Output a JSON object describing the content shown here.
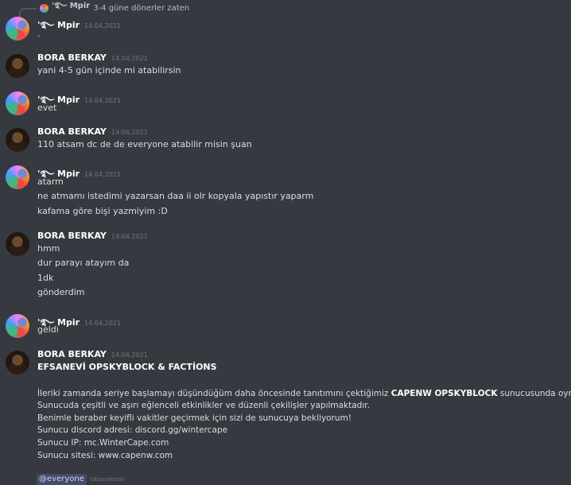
{
  "reply": {
    "author": "'࿐ Mpir",
    "text": "3-4 güne dönerler zaten"
  },
  "messages": [
    {
      "author": "'࿐ Mpir",
      "timestamp": "14.04.2021",
      "avatar": "mpir",
      "lines": [
        "."
      ]
    },
    {
      "author": "BORA BERKAY",
      "timestamp": "14.04.2021",
      "avatar": "bora",
      "lines": [
        "yani 4-5 gün içinde mi atabilirsin"
      ]
    },
    {
      "author": "'࿐ Mpir",
      "timestamp": "14.04.2021",
      "avatar": "mpir",
      "lines": [
        "evet"
      ]
    },
    {
      "author": "BORA BERKAY",
      "timestamp": "14.04.2021",
      "avatar": "bora",
      "lines": [
        "110 atsam dc de de everyone atabilir misin şuan"
      ]
    },
    {
      "author": "'࿐ Mpir",
      "timestamp": "14.04.2021",
      "avatar": "mpir",
      "lines": [
        "atarm",
        "ne atmamı istedimi yazarsan daa ii olr kopyala yapıstır yaparm",
        "kafama göre bişi yazmiyim :D"
      ]
    },
    {
      "author": "BORA BERKAY",
      "timestamp": "14.04.2021",
      "avatar": "bora",
      "lines": [
        "hmm",
        "dur parayı atayım da",
        "1dk",
        "gönderdim"
      ]
    },
    {
      "author": "'࿐ Mpir",
      "timestamp": "14.04.2021",
      "avatar": "mpir",
      "lines": [
        "geldi"
      ]
    },
    {
      "author": "BORA BERKAY",
      "timestamp": "14.04.2021",
      "avatar": "bora",
      "title": "EFSANEVİ OPSKYBLOCK & FACTİONS",
      "body": {
        "line1_prefix": "İleriki zamanda seriye başlamayı düşündüğüm daha öncesinde tanıtımını çektiğimiz",
        "line1_bold": "CAPENW OPSKYBLOCK",
        "line1_suffix": "sunucusunda oynayacağız.",
        "line2": "Sunucuda çeşitli ve aşırı eğlenceli etkinlikler ve düzenli çekilişler yapılmaktadır.",
        "line3": "Benimle beraber keyifli vakitler geçirmek için sizi de sunucuya bekliyorum!",
        "line4": "Sunucu discord adresi: discord.gg/wintercape",
        "line5": "Sunucu IP: mc.WinterCape.com",
        "line6": "Sunucu sitesi: www.capenw.com"
      },
      "mention": "@everyone",
      "edited": "(düzenlendi)"
    }
  ]
}
